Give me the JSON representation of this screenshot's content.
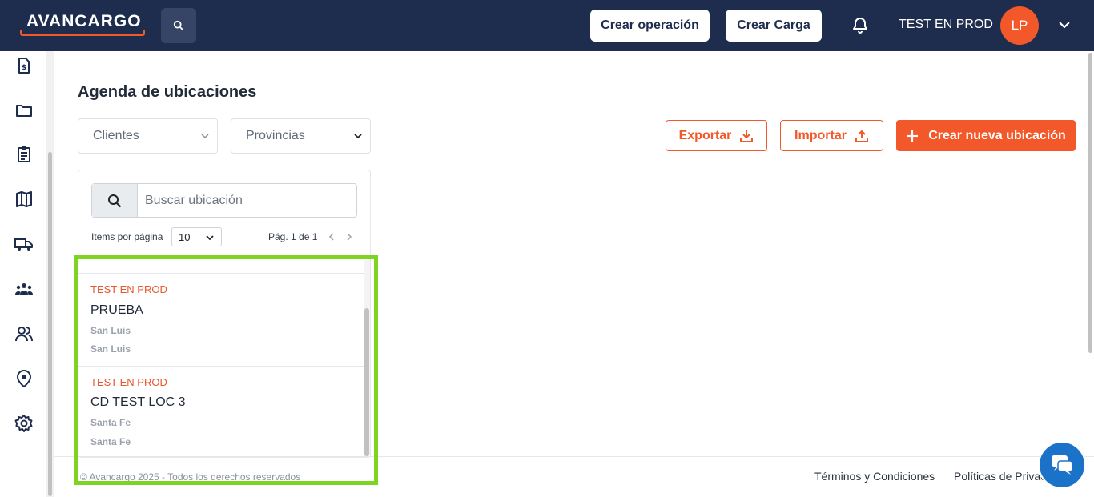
{
  "header": {
    "logo_text": "AVANCARGO",
    "create_operation_label": "Crear operación",
    "create_load_label": "Crear Carga",
    "user_name": "TEST EN PROD",
    "avatar_initials": "LP"
  },
  "sidebar": {
    "items": [
      {
        "icon": "invoice-icon"
      },
      {
        "icon": "folder-icon"
      },
      {
        "icon": "clipboard-icon"
      },
      {
        "icon": "map-icon"
      },
      {
        "icon": "truck-icon"
      },
      {
        "icon": "group-icon"
      },
      {
        "icon": "users-icon"
      },
      {
        "icon": "location-pin-icon"
      },
      {
        "icon": "settings-icon"
      }
    ]
  },
  "main": {
    "title": "Agenda de ubicaciones",
    "filters": {
      "clients_label": "Clientes",
      "provinces_label": "Provincias"
    },
    "actions": {
      "export_label": "Exportar",
      "import_label": "Importar",
      "create_label": "Crear nueva ubicación"
    },
    "search": {
      "placeholder": "Buscar ubicación"
    },
    "pagination": {
      "items_per_page_label": "Items por página",
      "items_per_page_value": "10",
      "page_info": "Pág. 1 de 1"
    },
    "locations": [
      {
        "client": "TEST EN PROD",
        "name": "PRUEBA",
        "city": "San Luis",
        "province": "San Luis"
      },
      {
        "client": "TEST EN PROD",
        "name": "CD TEST LOC 3",
        "city": "Santa Fe",
        "province": "Santa Fe"
      }
    ]
  },
  "footer": {
    "copyright": "© Avancargo 2025 - Todos los derechos reservados",
    "terms_label": "Términos y Condiciones",
    "privacy_label": "Políticas de Privacidad"
  },
  "colors": {
    "navy": "#1e2d4e",
    "accent": "#f2582a",
    "highlight": "#7fd321",
    "chat": "#1a73c8"
  }
}
